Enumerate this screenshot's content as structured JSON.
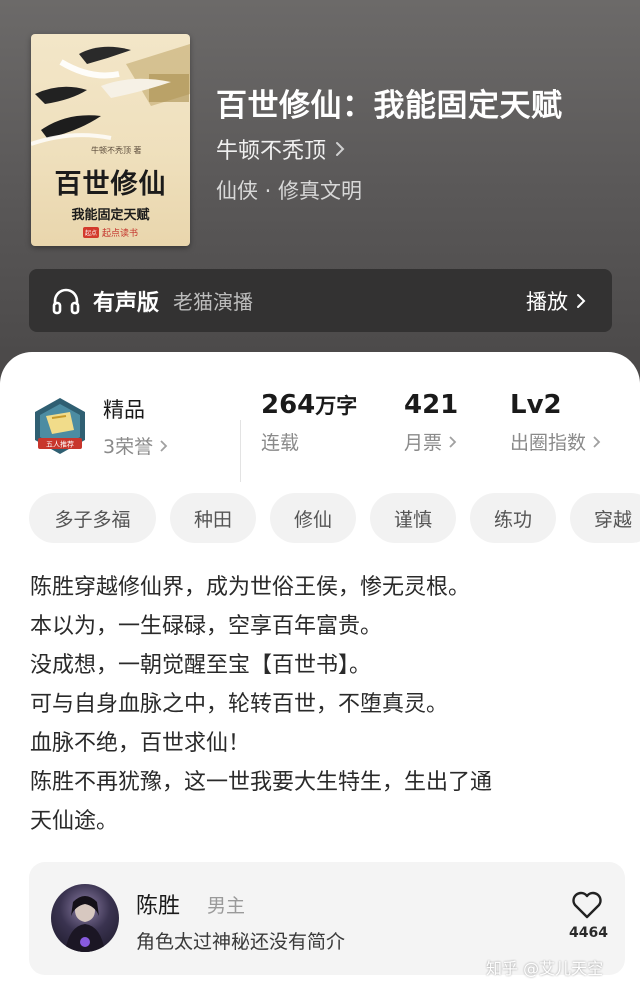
{
  "header": {
    "book_title": "百世修仙：我能固定天赋",
    "author": "牛顿不秃顶",
    "genre": "仙侠 · 修真文明"
  },
  "cover": {
    "title": "百世修仙",
    "subtitle": "我能固定天赋",
    "author_line": "牛顿不秃顶 著",
    "publisher": "起点读书",
    "publisher_badge": "起点"
  },
  "audio": {
    "label": "有声版",
    "narrator": "老猫演播",
    "play_label": "播放"
  },
  "stats": {
    "quality": "精品",
    "honors": "3荣誉",
    "emblem_text": "五人推荐",
    "word_count": "264",
    "word_unit": "万字",
    "status": "连载",
    "monthly_votes": "421",
    "monthly_votes_label": "月票",
    "level": "Lv2",
    "level_label": "出圈指数"
  },
  "tags": [
    "多子多福",
    "种田",
    "修仙",
    "谨慎",
    "练功",
    "穿越"
  ],
  "description": [
    "陈胜穿越修仙界，成为世俗王侯，惨无灵根。",
    "本以为，一生碌碌，空享百年富贵。",
    "没成想，一朝觉醒至宝【百世书】。",
    "可与自身血脉之中，轮转百世，不堕真灵。",
    "血脉不绝，百世求仙！",
    "陈胜不再犹豫，这一世我要大生特生，生出了通",
    "天仙途。"
  ],
  "character": {
    "name": "陈胜",
    "role": "男主",
    "intro": "角色太过神秘还没有简介",
    "likes": "4464"
  },
  "watermark": "知乎 @艾儿天空",
  "colors": {
    "hero_bg": "#5b5959",
    "panel_bg": "#ffffff",
    "tag_bg": "#f2f2f2",
    "card_bg": "#f4f4f4"
  }
}
